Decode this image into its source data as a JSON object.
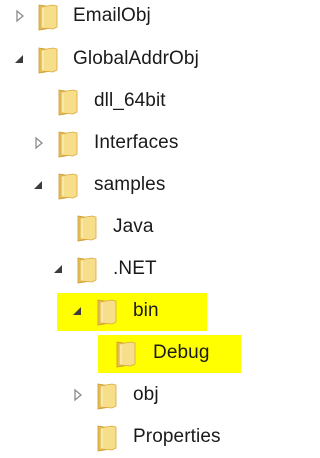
{
  "tree": {
    "items": [
      {
        "label": "EmailObj",
        "expander": "collapsed"
      },
      {
        "label": "GlobalAddrObj",
        "expander": "expanded"
      },
      {
        "label": "dll_64bit",
        "expander": "none"
      },
      {
        "label": "Interfaces",
        "expander": "collapsed"
      },
      {
        "label": "samples",
        "expander": "expanded"
      },
      {
        "label": "Java",
        "expander": "none"
      },
      {
        "label": ".NET",
        "expander": "expanded"
      },
      {
        "label": "bin",
        "expander": "expanded"
      },
      {
        "label": "Debug",
        "expander": "none"
      },
      {
        "label": "obj",
        "expander": "collapsed"
      },
      {
        "label": "Properties",
        "expander": "none"
      }
    ]
  },
  "colors": {
    "highlight": "#ffff00",
    "folder_light": "#f7de8a",
    "folder_dark": "#d9a93a",
    "expander_collapsed": "#8c8c8c",
    "expander_expanded": "#3c3c3c"
  },
  "icons": {
    "folder": "folder-icon",
    "collapsed": "expand-arrow-icon",
    "expanded": "collapse-arrow-icon"
  }
}
